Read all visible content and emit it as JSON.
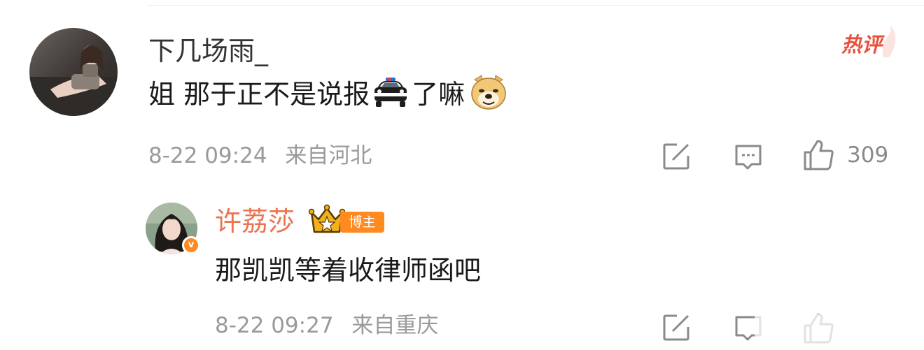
{
  "comment": {
    "username": "下几场雨_",
    "text_before": "姐 那于正不是说报",
    "text_after": "了嘛",
    "emoji_1": "police-car-emoji",
    "emoji_2": "doge-emoji",
    "time": "8-22 09:24",
    "location": "来自河北",
    "hot_badge": "热评",
    "like_count": "309",
    "username_color": "#333333"
  },
  "reply": {
    "username": "许荔莎",
    "badge_label": "博主",
    "text": "那凯凯等着收律师函吧",
    "time": "8-22 09:27",
    "location": "来自重庆",
    "username_color": "#eb7350",
    "badge_color": "#ff8a1f"
  },
  "icons": {
    "share": "share-icon",
    "comment": "comment-icon",
    "like": "thumbs-up-icon"
  }
}
